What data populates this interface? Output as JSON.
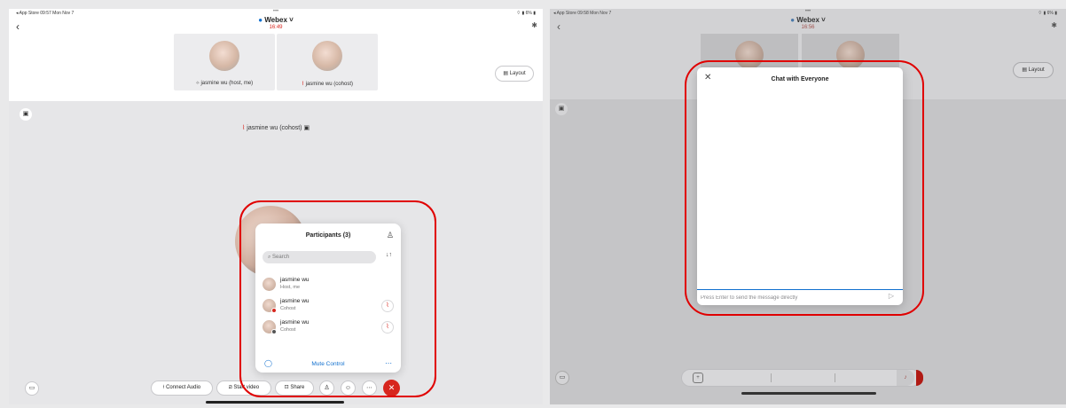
{
  "left": {
    "status": {
      "left": "◂ App Store  09:57  Mon Nov 7",
      "right": "⌔ ▮ 6% ▮"
    },
    "header": {
      "dots": "•••",
      "title": "Webex",
      "timer": "16:49"
    },
    "tiles": [
      {
        "label": "jasmine wu (host, me)",
        "mic": "⟡"
      },
      {
        "label": "jasmine wu (cohost)",
        "mic": "⌇"
      }
    ],
    "layout_label": "Layout",
    "stage_name": "jasmine wu (cohost)",
    "participants": {
      "title": "Participants (3)",
      "search_placeholder": "Search",
      "rows": [
        {
          "name": "jasmine wu",
          "role": "Host, me"
        },
        {
          "name": "jasmine wu",
          "role": "Cohost"
        },
        {
          "name": "jasmine wu",
          "role": "Cohost"
        }
      ],
      "mute_control": "Mute Control"
    },
    "controls": {
      "connect_audio": "Connect Audio",
      "start_video": "Start video",
      "share": "Share"
    }
  },
  "right": {
    "status": {
      "left": "◂ App Store  09:58  Mon Nov 7",
      "right": "⌔ ▮ 6% ▮"
    },
    "header": {
      "dots": "•••",
      "title": "Webex",
      "timer": "16:56"
    },
    "layout_label": "Layout",
    "chat": {
      "title": "Chat with Everyone",
      "input_placeholder": "Press Enter to send the message directly"
    }
  },
  "colors": {
    "accent_blue": "#1170cf",
    "webex_red": "#d7261e",
    "highlight_red": "#e00000"
  }
}
